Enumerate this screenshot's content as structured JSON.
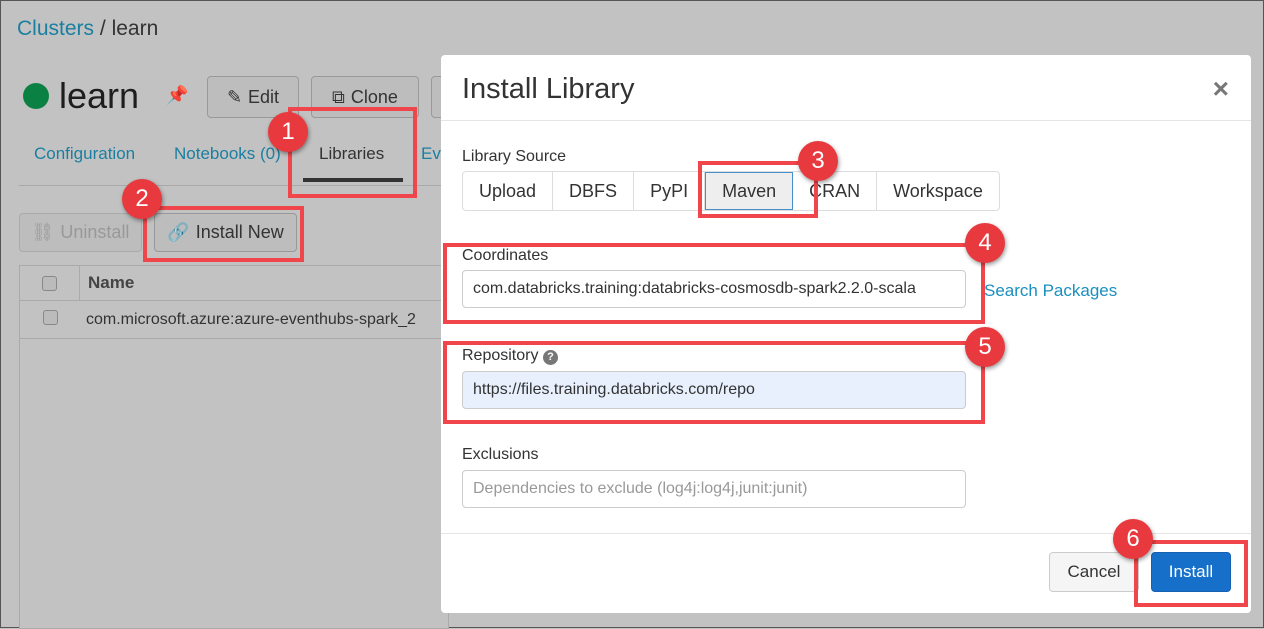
{
  "breadcrumb": {
    "parent": "Clusters",
    "sep": "/",
    "current": "learn"
  },
  "cluster": {
    "name": "learn",
    "status_color": "#0b8043"
  },
  "toolbar": {
    "edit": "Edit",
    "clone": "Clone"
  },
  "tabs": {
    "configuration": "Configuration",
    "notebooks": "Notebooks (0)",
    "libraries": "Libraries",
    "events": "Ev"
  },
  "actions": {
    "uninstall": "Uninstall",
    "install_new": "Install New"
  },
  "table": {
    "header": "Name",
    "rows": [
      "com.microsoft.azure:azure-eventhubs-spark_2"
    ]
  },
  "modal": {
    "title": "Install Library",
    "close": "×",
    "source_label": "Library Source",
    "sources": [
      "Upload",
      "DBFS",
      "PyPI",
      "Maven",
      "CRAN",
      "Workspace"
    ],
    "selected_source": "Maven",
    "coordinates_label": "Coordinates",
    "coordinates_value": "com.databricks.training:databricks-cosmosdb-spark2.2.0-scala",
    "search_packages": "Search Packages",
    "repository_label": "Repository",
    "repository_value": "https://files.training.databricks.com/repo",
    "exclusions_label": "Exclusions",
    "exclusions_placeholder": "Dependencies to exclude (log4j:log4j,junit:junit)",
    "cancel": "Cancel",
    "install": "Install"
  },
  "callouts": [
    "1",
    "2",
    "3",
    "4",
    "5",
    "6"
  ]
}
